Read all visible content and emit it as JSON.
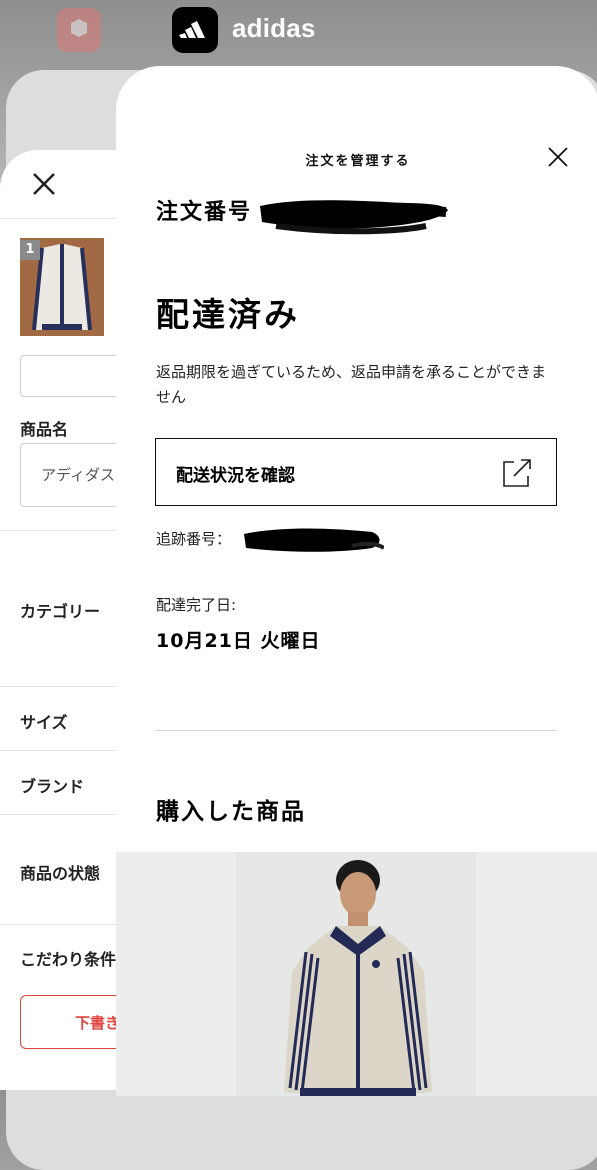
{
  "app_switcher": {
    "active_app": "adidas",
    "background_app_icon": "mercari-icon"
  },
  "background_app": {
    "thumb_badge": "1",
    "labels": {
      "product_name": "商品名",
      "product_name_value": "アディダス",
      "category": "カテゴリー",
      "size": "サイズ",
      "brand": "ブランド",
      "condition": "商品の状態",
      "preference": "こだわり条件"
    },
    "draft_button": "下書き"
  },
  "modal": {
    "title": "注文を管理する",
    "order_number_label": "注文番号",
    "status": "配達済み",
    "return_note": "返品期限を過ぎているため、返品申請を承ることができません",
    "tracking_button": "配送状況を確認",
    "tracking_number_label": "追跡番号：",
    "delivered_date_label": "配達完了日:",
    "delivered_date": "10月21日 火曜日",
    "purchased_items_title": "購入した商品"
  },
  "colors": {
    "mercari_red": "#e0443c",
    "adidas_black": "#000000"
  }
}
